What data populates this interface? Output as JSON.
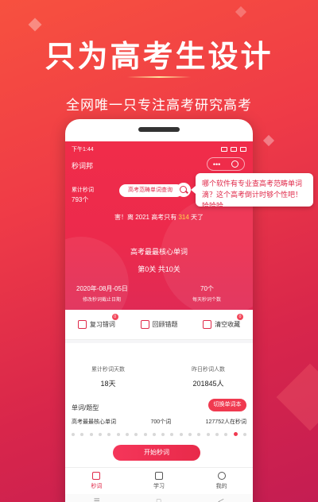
{
  "headline": "只为高考生设计",
  "subline": "全网唯一只专注高考研究高考",
  "status": {
    "time": "下午1:44"
  },
  "app": {
    "title": "秒词邦",
    "capsule_dots": "•••"
  },
  "summary": {
    "total_label": "累计秒词",
    "total_value": "793个"
  },
  "search": {
    "placeholder": "高考范畴单词查询"
  },
  "countdown": {
    "prefix": "害！离 2021 高考只有 ",
    "days": "314",
    "suffix": " 天了"
  },
  "core": {
    "title": "高考最最核心单词",
    "progress": "第0关 共10关"
  },
  "deadline": {
    "date": "2020年-08月-05日",
    "label": "修改秒词截止日期"
  },
  "daily": {
    "count": "70个",
    "label": "每天秒词个数"
  },
  "bubble": {
    "text": "哪个软件有专业查高考范畴单词滴？这个高考倒计时够个性吧！哈哈哈"
  },
  "actions": [
    {
      "label": "复习错词",
      "badge": "0"
    },
    {
      "label": "回顾错题",
      "badge": ""
    },
    {
      "label": "清空收藏",
      "badge": "0"
    }
  ],
  "stats": {
    "days_label": "累计秒词天数",
    "days_value": "18天",
    "users_label": "昨日秒词人数",
    "users_value": "201845人"
  },
  "words": {
    "section_title": "单词/题型",
    "switch_label": "切换单词本",
    "book_name": "高考最最核心单词",
    "book_count": "700个词",
    "book_users": "127752人在秒词",
    "dots_total": 20,
    "dots_active_index": 18,
    "start_label": "开始秒词"
  },
  "tabs": [
    {
      "label": "秒词",
      "active": true
    },
    {
      "label": "学习",
      "active": false
    },
    {
      "label": "我的",
      "active": false
    }
  ],
  "nav": {
    "menu": "☰",
    "home": "□",
    "back": "＜"
  },
  "colors": {
    "accent": "#e02a4a",
    "highlight": "#ffd84a"
  }
}
